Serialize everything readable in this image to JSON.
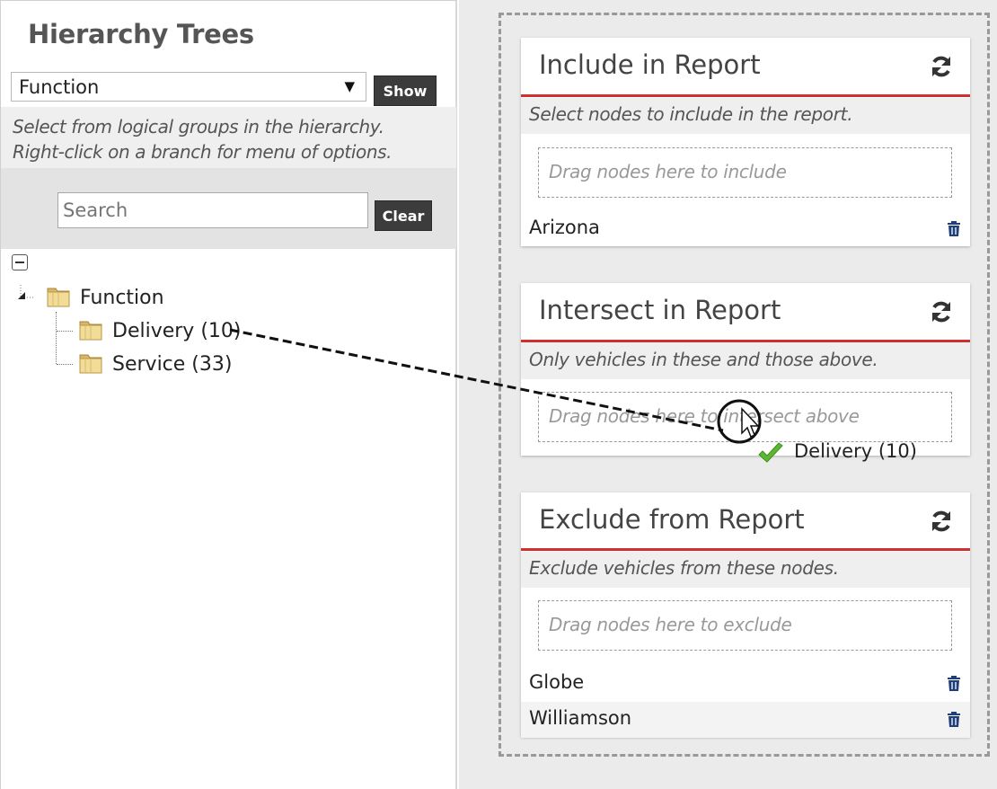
{
  "left": {
    "title": "Hierarchy Trees",
    "select_value": "Function",
    "select_arrow": "▼",
    "show_label": "Show",
    "help_line1": "Select from logical groups in the hierarchy.",
    "help_line2": "Right-click on a branch for menu of options.",
    "search_placeholder": "Search",
    "clear_label": "Clear",
    "tree": {
      "root": "Function",
      "children": [
        "Delivery (10)",
        "Service (33)"
      ]
    }
  },
  "cards": [
    {
      "title": "Include in Report",
      "subtitle": "Select nodes to include in the report.",
      "drop_hint": "Drag nodes here to include",
      "items": [
        "Arizona"
      ]
    },
    {
      "title": "Intersect in Report",
      "subtitle": "Only vehicles in these and those above.",
      "drop_hint": "Drag nodes here to intersect above",
      "items": []
    },
    {
      "title": "Exclude from Report",
      "subtitle": "Exclude vehicles from these nodes.",
      "drop_hint": "Drag nodes here to exclude",
      "items": [
        "Globe",
        "Williamson"
      ]
    }
  ],
  "drag": {
    "item_label": "Delivery (10)",
    "status_icon": "check-icon",
    "status_color": "#5cb82f"
  },
  "colors": {
    "accent_rule": "#d32f2f",
    "button_dark": "#3c3c3c",
    "trash_icon": "#1f3f7a"
  }
}
